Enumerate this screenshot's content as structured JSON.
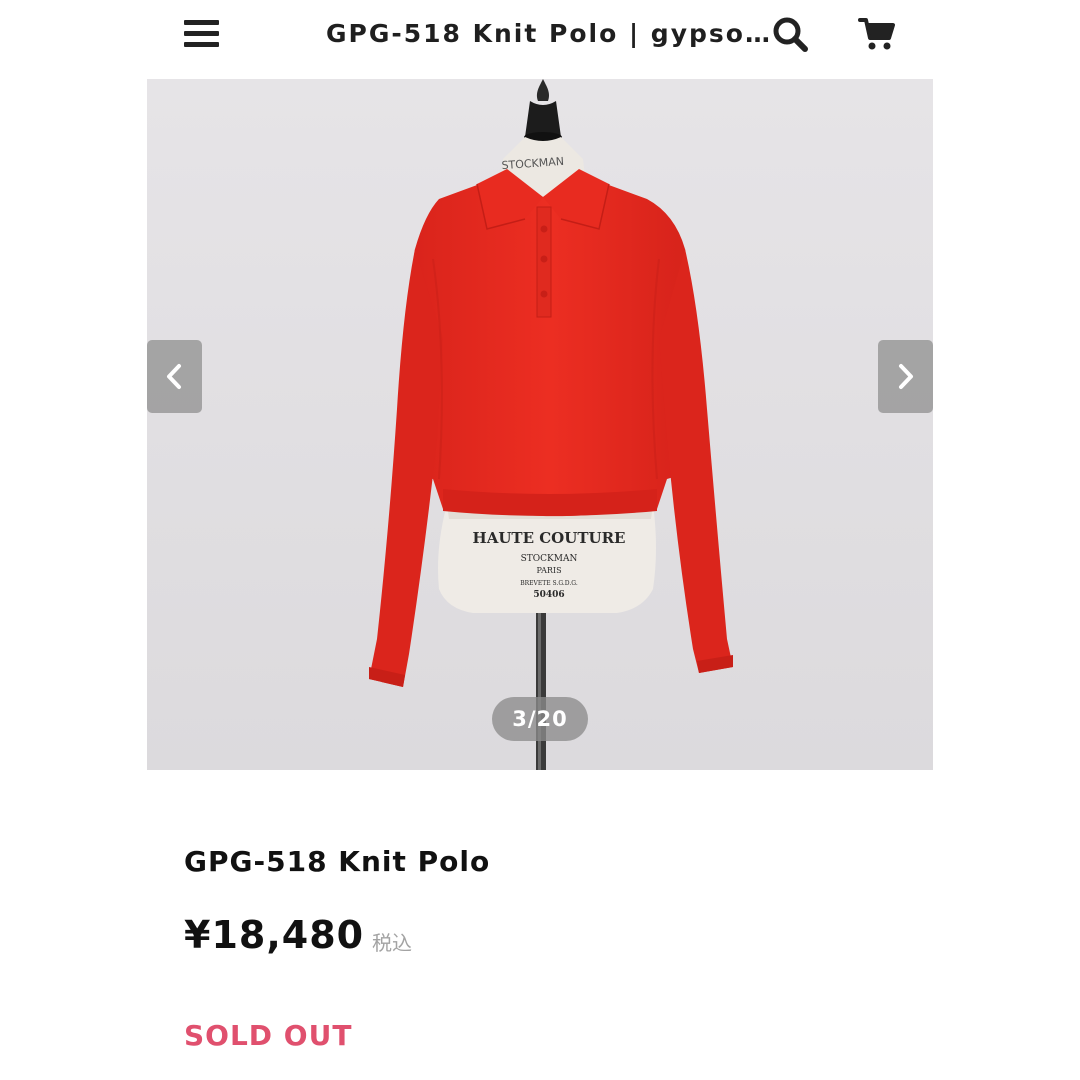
{
  "header": {
    "title": "GPG-518 Knit Polo | gypso…",
    "menu_icon": "hamburger-menu-icon",
    "search_icon": "search-icon",
    "cart_icon": "shopping-cart-icon"
  },
  "carousel": {
    "counter": "3/20",
    "prev_icon": "chevron-left-icon",
    "next_icon": "chevron-right-icon",
    "photo": {
      "mannequin_neck_label": "STOCKMAN",
      "mannequin_label_line1": "HAUTE COUTURE",
      "mannequin_label_line2": "STOCKMAN",
      "mannequin_label_line3": "PARIS",
      "mannequin_label_line4": "BREVETE S.G.D.G.",
      "mannequin_label_line5": "50406"
    }
  },
  "product": {
    "name": "GPG-518 Knit Polo",
    "price": "¥18,480",
    "tax_note": "税込",
    "status": "SOLD OUT"
  },
  "colors": {
    "sweater": "#e5291f",
    "sold_out": "#e0506e",
    "photo_background": "#e4e2e5",
    "text": "#111111",
    "muted": "#a3a3a3"
  }
}
